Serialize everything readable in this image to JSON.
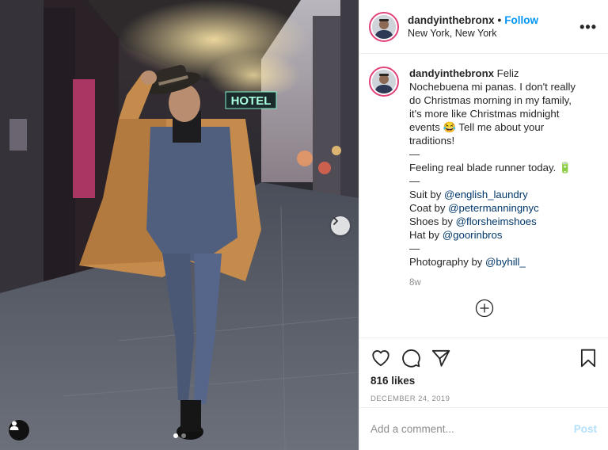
{
  "post": {
    "author": "dandyinthebronx",
    "follow_label": "Follow",
    "separator": "•",
    "location": "New York, New York",
    "more_label": "•••",
    "photo": {
      "sign_text": "HOTEL",
      "slide_count": 2,
      "active_slide": 0
    },
    "caption": {
      "author": "dandyinthebronx",
      "intro": "Feliz Nochebuena mi panas. I don't really do Christmas morning in my family, it's more like Christmas midnight events 😂 Tell me about your traditions!",
      "dash1": "—",
      "line_feeling": "Feeling real blade runner today. 🔋",
      "dash2": "—",
      "credits": [
        {
          "label": "Suit by ",
          "mention": "@english_laundry"
        },
        {
          "label": "Coat by ",
          "mention": "@petermanningnyc"
        },
        {
          "label": "Shoes by ",
          "mention": "@florsheimshoes"
        },
        {
          "label": "Hat by ",
          "mention": "@goorinbros"
        }
      ],
      "dash3": "—",
      "photo_credit_label": "Photography by ",
      "photo_credit_mention": "@byhill_",
      "time_ago": "8w"
    },
    "likes": "816 likes",
    "date": "DECEMBER 24, 2019",
    "comment_placeholder": "Add a comment...",
    "post_label": "Post"
  },
  "icons": {
    "like": "heart-icon",
    "comment": "comment-icon",
    "share": "paper-plane-icon",
    "save": "bookmark-icon",
    "load_more": "plus-circle-icon",
    "next": "chevron-right-icon",
    "tags": "user-tag-icon"
  },
  "colors": {
    "follow": "#0095f6",
    "mention": "#00376b",
    "avatar_ring": "#e0437a",
    "post_disabled": "#b2dffc",
    "secondary_text": "#8e8e8e"
  }
}
